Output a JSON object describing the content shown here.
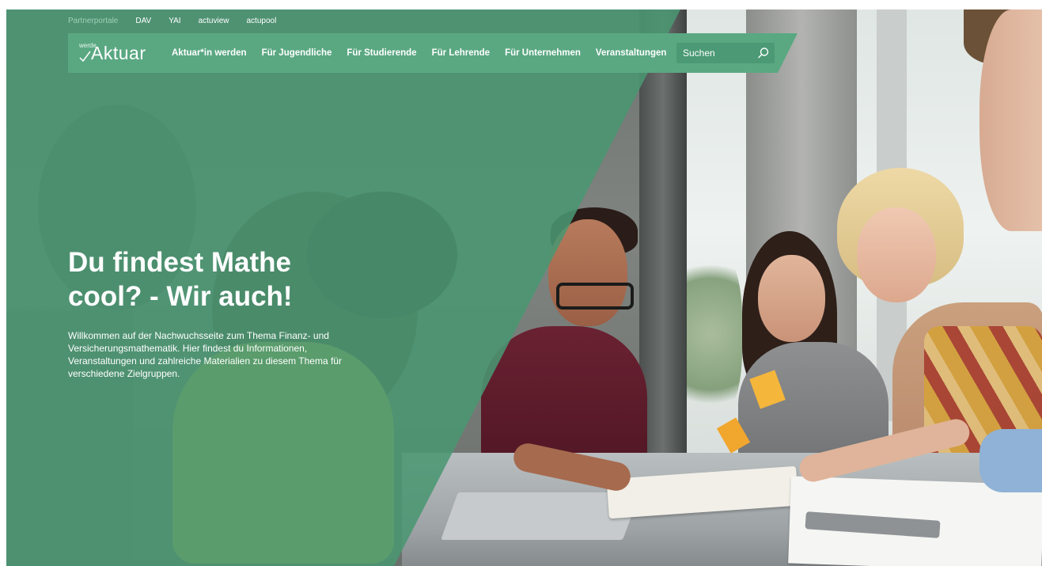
{
  "topbar": {
    "label": "Partnerportale",
    "links": [
      "DAV",
      "YAI",
      "actuview",
      "actupool"
    ]
  },
  "logo": {
    "prefix": "werde",
    "word": "Aktuar"
  },
  "nav": {
    "links": [
      "Aktuar*in werden",
      "Für Jugendliche",
      "Für Studierende",
      "Für Lehrende",
      "Für Unternehmen",
      "Veranstaltungen"
    ]
  },
  "search": {
    "placeholder": "Suchen",
    "icon": "search-icon"
  },
  "hero": {
    "title_line1": "Du findest Mathe",
    "title_line2": "cool? - Wir auch!",
    "text_line1": "Willkommen auf der Nachwuchsseite zum Thema Finanz- und",
    "text_line2": "Versicherungsmathematik. Hier findest du Informationen,",
    "text_line3": "Veranstaltungen und zahlreiche Materialien zu diesem Thema für",
    "text_line4": "verschiedene Zielgruppen."
  },
  "colors": {
    "overlay_green": "#4a9672",
    "nav_green": "#5aa882",
    "search_green": "#4b9a75",
    "text": "#ffffff"
  }
}
